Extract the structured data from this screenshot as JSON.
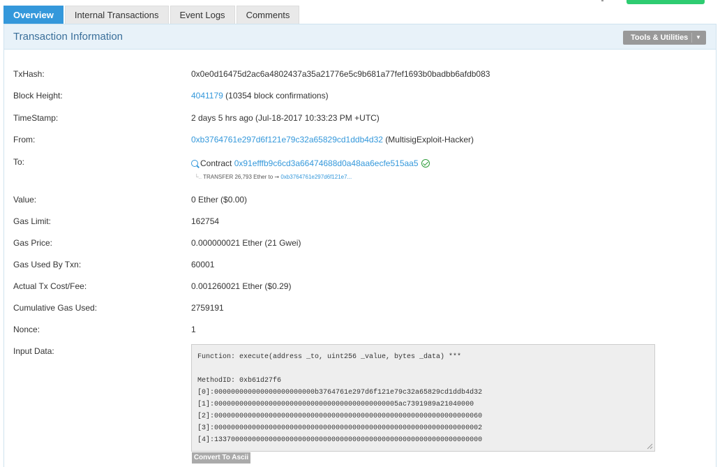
{
  "tabs": [
    {
      "label": "Overview",
      "active": true
    },
    {
      "label": "Internal Transactions",
      "active": false
    },
    {
      "label": "Event Logs",
      "active": false
    },
    {
      "label": "Comments",
      "active": false
    }
  ],
  "panel": {
    "title": "Transaction Information",
    "tools_label": "Tools & Utilities"
  },
  "fields": {
    "txhash": {
      "label": "TxHash:",
      "value": "0x0e0d16475d2ac6a4802437a35a21776e5c9b681a77fef1693b0badbb6afdb083"
    },
    "block": {
      "label": "Block Height:",
      "link": "4041179",
      "suffix": "(10354 block confirmations)"
    },
    "timestamp": {
      "label": "TimeStamp:",
      "value": "2 days 5 hrs ago (Jul-18-2017 10:33:23 PM +UTC)"
    },
    "from": {
      "label": "From:",
      "link": "0xb3764761e297d6f121e79c32a65829cd1ddb4d32",
      "suffix": "(MultisigExploit-Hacker)"
    },
    "to": {
      "label": "To:",
      "prefix": "Contract",
      "link": "0x91efffb9c6cd3a66474688d0a48aa6ecfe515aa5",
      "transfer_text": "TRANSFER  26,793 Ether  to",
      "transfer_link": "0xb3764761e297d6f121e7..."
    },
    "value": {
      "label": "Value:",
      "value": "0 Ether ($0.00)"
    },
    "gas_limit": {
      "label": "Gas Limit:",
      "value": "162754"
    },
    "gas_price": {
      "label": "Gas Price:",
      "value": "0.000000021 Ether (21 Gwei)"
    },
    "gas_used": {
      "label": "Gas Used By Txn:",
      "value": "60001"
    },
    "tx_fee": {
      "label": "Actual Tx Cost/Fee:",
      "value": "0.001260021 Ether ($0.29)"
    },
    "cumulative": {
      "label": "Cumulative Gas Used:",
      "value": "2759191"
    },
    "nonce": {
      "label": "Nonce:",
      "value": "1"
    },
    "input": {
      "label": "Input Data:",
      "function_line": "Function: execute(address _to, uint256 _value, bytes _data) ***",
      "method_line": "MethodID: 0xb61d27f6",
      "params": [
        "[0]:000000000000000000000000b3764761e297d6f121e79c32a65829cd1ddb4d32",
        "[1]:00000000000000000000000000000000000000000005ac7391989a21040000",
        "[2]:0000000000000000000000000000000000000000000000000000000000000060",
        "[3]:0000000000000000000000000000000000000000000000000000000000000002",
        "[4]:1337000000000000000000000000000000000000000000000000000000000000"
      ],
      "convert_label": "Convert To Ascii"
    }
  },
  "colors": {
    "tab_active": "#3498db",
    "link": "#3498db",
    "panel_head": "#e8f2f9",
    "title": "#3a6f9a",
    "success": "#2e9d3a"
  }
}
